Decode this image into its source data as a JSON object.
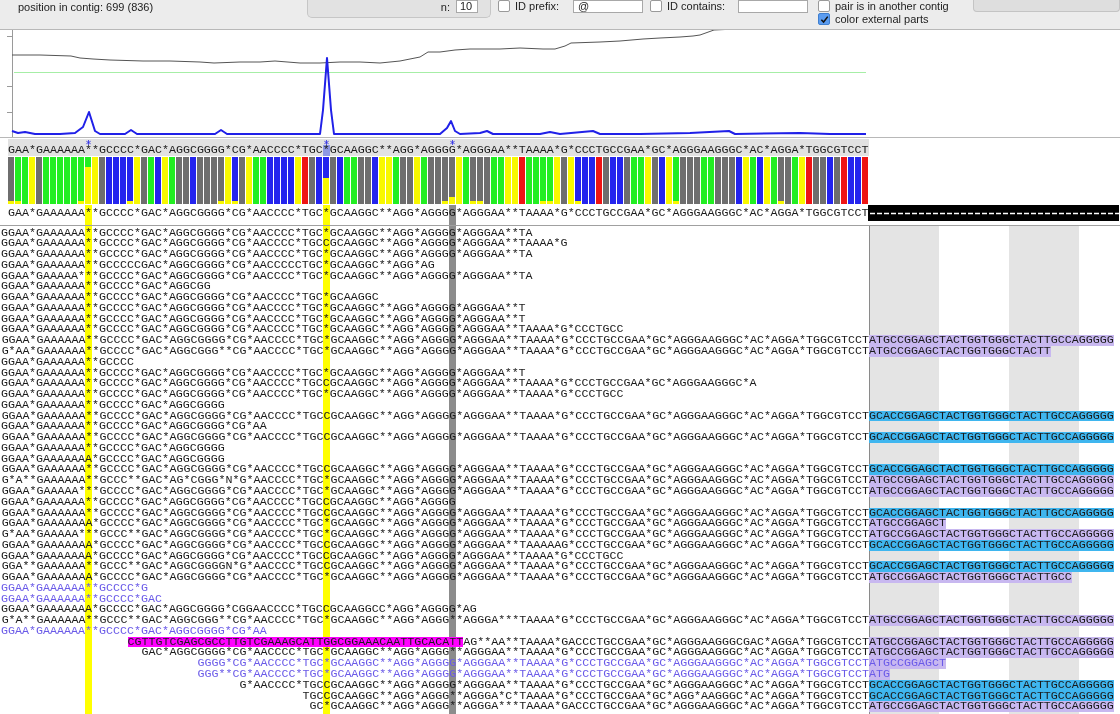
{
  "toolbar": {
    "position": "position in contig: 699 (836)",
    "n_label": "n:",
    "n_value": "10",
    "filters": [
      {
        "label": "ID prefix:",
        "checked": false,
        "value": "@"
      },
      {
        "label": "ID contains:",
        "checked": false
      }
    ],
    "checkboxes": [
      {
        "label": "pair is in another contig",
        "checked": false
      },
      {
        "label": "color external parts",
        "checked": true
      }
    ]
  },
  "consensus_top": [
    {
      "text": "GAA*GAAAAAA",
      "marked": false,
      "selected": false
    },
    {
      "text": "*",
      "marked": true,
      "selected": false
    },
    {
      "text": "*GCCCC*GAC*AGGCGGGG*CG*AACCCC*TGC",
      "marked": false,
      "selected": false
    },
    {
      "text": "*",
      "marked": true,
      "selected": true
    },
    {
      "text": "GCAAGGC**AGG*AGGG",
      "marked": false,
      "selected": false
    },
    {
      "text": "G",
      "marked": true,
      "selected": false
    },
    {
      "text": "*AGGGAA**TAAAA*G*CCCTGCCGAA*GC*AGGGAAGGGC*AC*AGGA*TGGCGTCCT",
      "marked": false,
      "selected": false
    }
  ],
  "consensus_bottom": [
    {
      "text": "GAA*GAAAAAA"
    },
    {
      "text": "*",
      "color": "#ffff00"
    },
    {
      "text": "*GCCCC*GAC*AGGCGGGG*CG*AACCCC*TGC"
    },
    {
      "text": "*",
      "color": "#ffff00"
    },
    {
      "text": "GCAAGGC**AGG*AGGG"
    },
    {
      "text": "G",
      "color": "#8c8c8c"
    },
    {
      "text": "*AGGGAA**TAAAA*G*CCCTGCCGAA*GC*AGGGAAGGGC*AC*AGGA*TGGCGTCCT"
    }
  ],
  "reads": [
    {
      "text": "GGAA*GAAAAAA**GCCCC*GAC*AGGCGGGG*CG*AACCCC*TGC*GCAAGGC**AGG*AGGGG*AGGGAA**TA"
    },
    {
      "text": "GGAA*GAAAAAA**GCCCC*GAC*AGGCGGGG*CG*AACCCC*TGCCGCAAGGC**AGG*AGGGG*AGGGAA**TAAAA*G"
    },
    {
      "text": "GGAA*GAAAAAA**GCCCC*GAC*AGGCGGGG*CG*AACCCC*TGC*GCAAGGC**AGG*AGGGG*AGGGAA**TA"
    },
    {
      "text": "GGAA*GAAAAAA**GCCCCCGAC*AGGCGGGG*CG*AACCCCCTGC*GCAAGGC**AGG*AG"
    },
    {
      "text": "GGAA*GAAAAA***GCCCC*GAC*AGGCGGGG*CG*AACCCC*TGC*GCAAGGC**AGG*AGGGG*AGGGAA**TA"
    },
    {
      "text": "GGAA*GAAAAAA**GCCCC*GAC*AGGCGG"
    },
    {
      "text": "GGAA*GAAAAAA**GCCCC*GAC*AGGCGGGG*CG*AACCCC*TGC*GCAAGGC"
    },
    {
      "text": "GGAA*GAAAAAA**GCCCC*GAC*AGGCGGGG*CG*AACCCC*TGC*GCAAGGC**AGG*AGGGG*AGGGAA**T"
    },
    {
      "text": "GGAA*GAAAAAA**GCCCC*GAC*AGGCGGGG*CG*AACCCC*TGC*GCAAGGC**AGG*AGGGG*AGGGAA**T"
    },
    {
      "text": "GGAA*GAAAAAA**GCCCC*GAC*AGGCGGGG*CG*AACCCC*TGC*GCAAGGC**AGG*AGGGG*AGGGAA**TAAAA*G*CCCTGCC"
    },
    {
      "text": "GGAA*GAAAAAA**GCCCC*GAC*AGGCGGGG*CG*AACCCC*TGC*GCAAGGC**AGG*AGGGG*AGGGAA**TAAAA*G*CCCTGCCGAA*GC*AGGGAAGGGC*AC*AGGA*TGGCGTCCT",
      "tail": {
        "text": "ATGCCGGAGCTACTGGTGGGCTACTTGCCAGGGGG",
        "color": "#c8b8f0"
      }
    },
    {
      "text": "G*AA*GAAAAAA**GCCCC*GAC*AGGCGGG**CG*AACCCC*TGC*GCAAGGC**AGG*AGGGG*AGGGAA**TAAAA*G*CCCTGCCGAA*GC*AGGGAAGGGC*AC*AGGA*TGGCGTCCT",
      "tail": {
        "text": "ATGCCGGAGCTACTGGTGGGCTACTT",
        "color": "#c8b8f0"
      }
    },
    {
      "text": "GGAA*GAAAAAA**GCCCC"
    },
    {
      "text": "GGAA*GAAAAAA**GCCCC*GAC*AGGCGGGG*CG*AACCCC*TGC*GCAAGGC**AGG*AGGGG*AGGGAA**T"
    },
    {
      "text": "GGAA*GAAAAAA**GCCCC*GAC*AGGCGGGG*CG*AACCCC*TGCCGCAAGGC**AGG*AGGGG*AGGGAA**TAAAA*G*CCCTGCCGAA*GC*AGGGAAGGGC*A"
    },
    {
      "text": "GGAA*GAAAAAA**GCCCC*GAC*AGGCGGGG*CG*AACCCC*TGC*GCAAGGC**AGG*AGGGG*AGGGAA**TAAAA*G*CCCTGCC"
    },
    {
      "text": "GGAA*GAAAAAA**GCCCC*GAC*AGGCGGGG"
    },
    {
      "text": "GGAA*GAAAAAA**GCCCC*GAC*AGGCGGGG*CG*AACCCC*TGCCGCAAGGC**AGG*AGGGG*AGGGAA**TAAAA*G*CCCTGCCGAA*GC*AGGGAAGGGC*AC*AGGA*TGGCGTCCT",
      "tail": {
        "text": "GCACCGGAGCTACTGGTGGGCTACTTGCCAGGGGG",
        "color": "#3fb6ef"
      }
    },
    {
      "text": "GGAA*GAAAAAA**GCCCC*GAC*AGGCGGGG*CG*AA"
    },
    {
      "text": "GGAA*GAAAAAA**GCCCC*GAC*AGGCGGGG*CG*AACCCC*TGCCGCAAGGC**AGG*AGGGG*AGGGAA**TAAAA*G*CCCTGCCGAA*GC*AGGGAAGGGC*AC*AGGA*TGGCGTCCT",
      "tail": {
        "text": "GCACCGGAGCTACTGGTGGGCTACTTGCCAGGGGG",
        "color": "#3fb6ef"
      }
    },
    {
      "text": "GGAA*GAAAAAA**GCCCC*GAC*AGGCGGGG"
    },
    {
      "text": "GGAA*GAAAAAAA*GCCCC*GAC*AGGCGGGG"
    },
    {
      "text": "GGAA*GAAAAAA**GCCCC*GAC*AGGCGGGG*CG*AACCCC*TGCCGCAAGGC**AGG*AGGGG*AGGGAA**TAAAA*G*CCCTGCCGAA*GC*AGGGAAGGGC*AC*AGGA*TGGCGTCCT",
      "tail": {
        "text": "GCACCGGAGCTACTGGTGGGCTACTTGCCAGGGGG",
        "color": "#3fb6ef"
      }
    },
    {
      "text": "G*A**GAAAAAA**GCCC**GAC*AG*CGGG*N*G*AACCCC*TGC*GCAAGGC**AGG*AGGGG*AGGGAA**TAAAA*G*CCCTGCCGAA*GC*AGGGAAGGGC*AC*AGGA*TGGCGTCCT",
      "tail": {
        "text": "ATGCCGGAGCTACTGGTGGGCTACTTGCCAGGGGG",
        "color": "#c8b8f0"
      }
    },
    {
      "text": "GGAA*GAAAAA***GCCCC*GAC*AGGCGGGG*CG*AACCCC*TGC*GCAAGGC**AGG*AGGGG*AGGGAA**TAAAA*G*CCCTGCCGAA*GC*AGGGAAGGGC*AC*AGGA*TGGCGTCCT",
      "tail": {
        "text": "ATGCCGGAGCTACTGGTGGGCTACTTGCCAGGGGG",
        "color": "#c8b8f0"
      }
    },
    {
      "text": "GGAA*GAAAAAA**GCCCC*GAC*AGGCGGGG*CG*AACCCC*TGCCGCAAGGC**AGG*AGGGG"
    },
    {
      "text": "GGAA*GAAAAAA**GCCCC*GAC*AGGCGGGG*CG*AACCCC*TGCCGCAAGGC**AGG*AGGGG*AGGGAA**TAAAA*G*CCCTGCCGAA*GC*AGGGAAGGGC*AC*AGGA*TGGCGTCCT",
      "tail": {
        "text": "GCACCGGAGCTACTGGTGGGCTACTTGCCAGGGGG",
        "color": "#3fb6ef"
      }
    },
    {
      "text": "GGAA*GAAAAAAA*GCCCC*GAC*AGGCGGGG*CG*AACCCC*TGC*GCAAGGC**AGG*AGGGG*AGGGAA**TAAAA*G*CCCTGCCGAA*GC*AGGGAAGGGC*AC*AGGA*TGGCGTCCT",
      "tail": {
        "text": "ATGCCGGAGCT",
        "color": "#c8b8f0"
      }
    },
    {
      "text": "G*AA*GAAAAA***GCCC**GAC*AGGCGGGG*CG*AACCCC*TGC*GCAAGGC**AGG*AGGGG*AGGGAA**TAAAA*G*CCCTGCCGAA*GC*AGGGAAGGGC*AC*AGGA*TGGCGTCCT",
      "tail": {
        "text": "ATGCCGGAGCTACTGGTGGGCTACTTGCCAGGGGG",
        "color": "#c8b8f0"
      }
    },
    {
      "text": "GGAA*GAAAAAAA*GCCCC*GAC*AGGCGGGG*CG*AACCCC*TGCCGCAAGGC**AGG*AGGGG*AGGGAA**TAAAAAG*CCCTGCCGAA*GC*AGGGAAGGGC*AC*AGGA*TGGCGTCCT",
      "tail": {
        "text": "GCACCGGAGCTACTGGTGGGCTACTTGCCAGGGGG",
        "color": "#3fb6ef"
      }
    },
    {
      "text": "GGAA*GAAAAAAA*GCCCC*GAC*AGGCGGGG*CG*AACCCC*TGCCGCAAGGC**AGG*AGGGG*AGGGAA**TAAAA*G*CCCTGCC"
    },
    {
      "text": "GGA**GAAAAAA**GCCC**GAC*AGGCGGGGN*G*AACCCC*TGCCGCAAGGC**AGG*AGGGG*AGGGAA**TAAAA*G*CCCTGCCGAA*GC*AGGGAAGGGC*AC*AGGA*TGGCGTCCT",
      "tail": {
        "text": "GCACCGGAGCTACTGGTGGGCTACTTGCCAGGGGG",
        "color": "#3fb6ef"
      }
    },
    {
      "text": "GGAA*GAAAAAAA*GCCCC*GAC*AGGCGGGG*CG*AACCCC*TGC*GCAAGGC**AGG*AGGGG*AGGGAA**TAAAA*G*CCCTGCCGAA*GC*AGGGAAGGGC*AC*AGGA*TGGCGTCCT",
      "tail": {
        "text": "ATGCCGGAGCTACTGGTGGGCTACTTGCC",
        "color": "#c8b8f0"
      }
    },
    {
      "text": "GGAA*GAAAAAA**GCCCC*G",
      "color": "#6a5ae8"
    },
    {
      "text": "GGAA*GAAAAAA**GCCCC*GAC",
      "color": "#6a5ae8"
    },
    {
      "text": "GGAA*GAAAAAAA*GCCCC*GAC*AGGCGGGG*CGGAACCCC*TGCCGCAAGGCC*AGG*AGGGG*AG"
    },
    {
      "text": "G*A**GAAAAAA**GCCC**GAC*AGGCGGG**CG*AACCCC*TGC*GCAAGGC**AGG*AGGG**AGGGA***TAAAA*G*CCCTGCCGAA*GC*AGGGAAGGGC*AC*AGGA*TGGCGTCCT",
      "tail": {
        "text": "ATGCCGGAGCTACTGGTGGGCTACTTGCCAGGGGG",
        "color": "#c8b8f0"
      }
    },
    {
      "text": "GGAA*GAAAAAA**GCCCC*GAC*AGGCGGGG*CG*AA",
      "color": "#6a5ae8"
    },
    {
      "clip": {
        "text": "CGTTGTCGAGCGCCTTGTCGAAAGCATTGGCGGAAACAATTGCACATT",
        "color": "#ff00ff"
      },
      "text": "AG**AA**TAAAA*GACCCTGCCGAA*GC*AGGGAAGGGCGAC*AGGA*TGGCGTCCT",
      "tail": {
        "text": "ATGCCGGAGCTACTGGTGGGCTACTTGCCAGGGGG",
        "color": "#c8b8f0"
      }
    },
    {
      "text": "GAC*AGGCGGGG*CG*AACCCC*TGC*GCAAGGC**AGG*AGGG**AGGGAA**TAAAA*G*CCCTGCCGAA*GC*AGGGAAGGGC*AC*AGGA*TGGCGTCCT",
      "tail": {
        "text": "ATGCCGGAGCTACTGGTGGGCTACTTGCCAGGGGG",
        "color": "#c8b8f0"
      }
    },
    {
      "text": "GGGG*CG*AACCCC*TGC*GCAAGGC**AGG*AGGGG*AGGGAA**TAAAA*G*CCCTGCCGAA*GC*AGGGAAGGGC*AC*AGGA*TGGCGTCCT",
      "color": "#6a5ae8",
      "tail": {
        "text": "ATGCCGGAGCT",
        "color": "#c8b8f0"
      }
    },
    {
      "text": "GGG**CG*AACCCC*TGC*GCAAGGC**AGG*AGGGG*AGGGAA**TAAAA*G*CCCTGCCGAA*GC*AGGGAAGGGC*AC*AGGA*TGGCGTCCT",
      "color": "#6a5ae8",
      "tail": {
        "text": "ATG",
        "color": "#c8b8f0"
      }
    },
    {
      "text": "G*AACCCC*TGCCGCAAGGC**AGG*AGGGG*AGGGAA**TAAAA*G*CCCTGCCGAA*GC*AGGGAAGGGC*AC*AGGA*TGGCGTCCT",
      "tail": {
        "text": "GCACCGGAGCTACTGGTGGGCTACTTGCCAGGGGG",
        "color": "#3fb6ef"
      }
    },
    {
      "text": "TGCCGCAAGGC**AGG*AGGG**AGGGA*C*TAAAA*G*CCCTGCCGAA*GC*AGG*AAGGGC*AC*AGGA*TGGCGTCCT",
      "tail": {
        "text": "GCACCGGAGCTACTGGTGGGCTACTTGCCAGGGGG",
        "color": "#3fb6ef"
      }
    },
    {
      "text": "GC*GCAAGGC**AGG*AGGG**AGGGA***TAAAA*GACCCTGCCGAA*GC*AGGGAAGGGC*AC*AGGA*TGGCGTCCT",
      "tail": {
        "text": "ATGCCGGAGCTACTGGTGGGCTACTTGCCAGGGGG",
        "color": "#c8b8f0"
      }
    }
  ]
}
